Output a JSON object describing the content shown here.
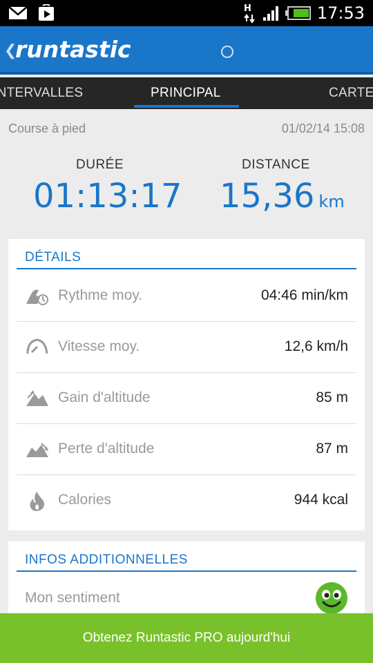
{
  "status_bar": {
    "time": "17:53",
    "network": "H"
  },
  "app_bar": {
    "logo": "runtastic"
  },
  "tabs": [
    {
      "label": "INTERVALLES"
    },
    {
      "label": "PRINCIPAL"
    },
    {
      "label": "CARTE"
    }
  ],
  "activity": {
    "type": "Course à pied",
    "datetime": "01/02/14 15:08",
    "duration_label": "DURÉE",
    "duration_value": "01:13:17",
    "distance_label": "DISTANCE",
    "distance_value": "15,36",
    "distance_unit": "km"
  },
  "details": {
    "title": "DÉTAILS",
    "rows": [
      {
        "label": "Rythme moy.",
        "value": "04:46 min/km"
      },
      {
        "label": "Vitesse moy.",
        "value": "12,6  km/h"
      },
      {
        "label": "Gain d'altitude",
        "value": "85 m"
      },
      {
        "label": "Perte d'altitude",
        "value": "87 m"
      },
      {
        "label": "Calories",
        "value": "944 kcal"
      }
    ]
  },
  "additional": {
    "title": "INFOS ADDITIONNELLES",
    "feeling_label": "Mon sentiment"
  },
  "banner": {
    "text": "Obtenez Runtastic PRO aujourd'hui"
  },
  "colors": {
    "accent": "#1a76c9",
    "banner": "#79c12a",
    "smiley": "#5cb82b"
  }
}
